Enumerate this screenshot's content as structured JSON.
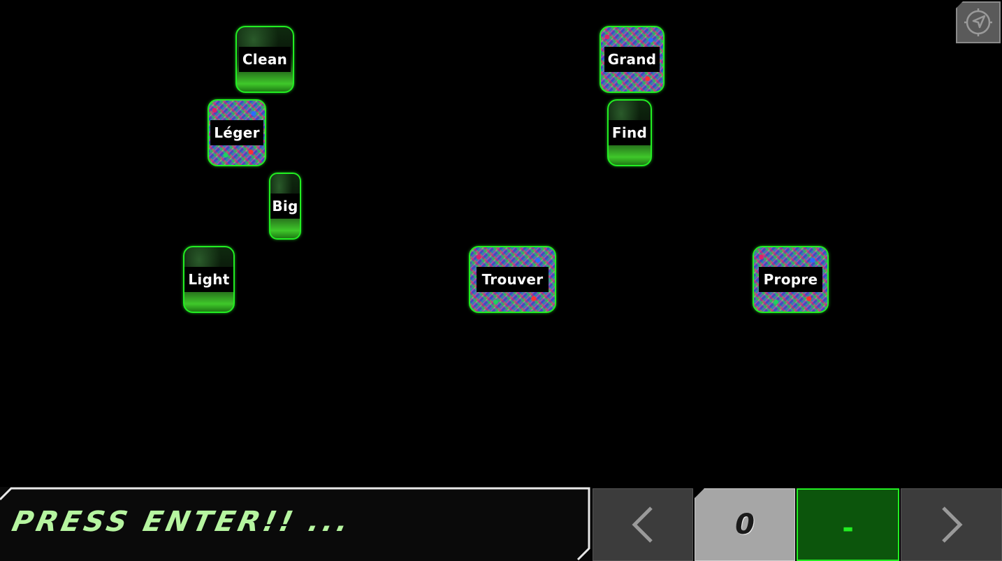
{
  "cards": [
    {
      "id": "clean",
      "label": "Clean",
      "style": "green"
    },
    {
      "id": "grand",
      "label": "Grand",
      "style": "noise"
    },
    {
      "id": "leger",
      "label": "Léger",
      "style": "noise"
    },
    {
      "id": "find",
      "label": "Find",
      "style": "green"
    },
    {
      "id": "big",
      "label": "Big",
      "style": "green"
    },
    {
      "id": "light",
      "label": "Light",
      "style": "green"
    },
    {
      "id": "trouver",
      "label": "Trouver",
      "style": "noise"
    },
    {
      "id": "propre",
      "label": "Propre",
      "style": "noise"
    }
  ],
  "top_right": {
    "icon": "navigation-arrow-icon"
  },
  "prompt": {
    "text": "PRESS ENTER!! ..."
  },
  "controls": {
    "prev_icon": "chevron-left-icon",
    "counter": "0",
    "cursor": "-",
    "next_icon": "chevron-right-icon"
  },
  "colors": {
    "accent": "#22ee22",
    "prompt_text": "#b6f5a0",
    "background": "#000000"
  }
}
